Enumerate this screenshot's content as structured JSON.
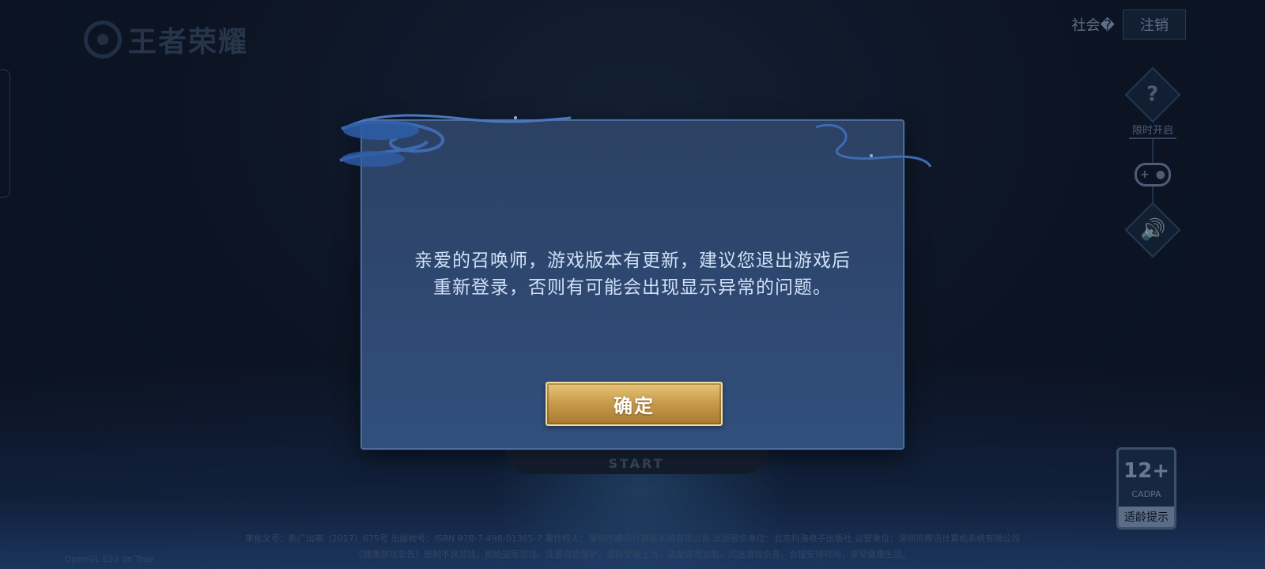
{
  "app": {
    "logo_text": "王者荣耀"
  },
  "topbar": {
    "social_label": "社会�",
    "logout_label": "注销"
  },
  "side_tools": {
    "help_icon_glyph": "?",
    "help_label": "限时开启",
    "gamepad_icon": "gamepad-icon",
    "sound_icon": "sound-icon"
  },
  "background": {
    "start_text": "START"
  },
  "dialog": {
    "message_line1": "亲爱的召唤师，游戏版本有更新，建议您退出游戏后",
    "message_line2": "重新登录，否则有可能会出现显示异常的问题。",
    "confirm_label": "确定"
  },
  "age_rating": {
    "value": "12+",
    "org": "CADPA",
    "label": "适龄提示"
  },
  "footer": {
    "line1": "审批文号：新广出审〔2017〕675号 出版物号：ISBN 978-7-498-01365-7 著作权人：深圳市腾讯计算机系统有限公司 出版服务单位：北京科海电子出版社 运营单位：深圳市腾讯计算机系统有限公司",
    "line2": "《健康游戏忠告》抵制不良游戏，拒绝盗版游戏。注意自我保护，谨防受骗上当。适度游戏益脑，沉迷游戏伤身。合理安排时间，享受健康生活。",
    "renderer": "OpenGL ES3 on True"
  },
  "colors": {
    "dialog_bg": "#2f4872",
    "dialog_border": "#4a6d9a",
    "confirm_gold": "#c99d4d",
    "text_primary": "#cfe0f7"
  }
}
